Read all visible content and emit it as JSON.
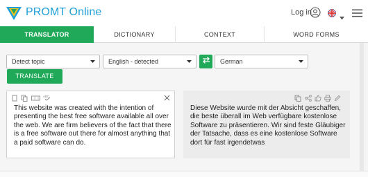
{
  "header": {
    "app_title": "PROMT Online",
    "login_label": "Log in",
    "brand_color": "#1f9fd8"
  },
  "tabs": [
    {
      "label": "TRANSLATOR",
      "active": true
    },
    {
      "label": "DICTIONARY",
      "active": false
    },
    {
      "label": "CONTEXT",
      "active": false
    },
    {
      "label": "WORD FORMS",
      "active": false
    }
  ],
  "controls": {
    "topic_select": "Detect topic",
    "source_lang_select": "English - detected",
    "target_lang_select": "German",
    "translate_button": "TRANSLATE",
    "accent_color": "#20a959"
  },
  "source": {
    "text": "This website was created with the intention of presenting the best free software available all over the web. We are firm believers of the fact that there is a free software out there for almost anything that a paid software can do."
  },
  "target": {
    "text": "Diese Website wurde mit der Absicht geschaffen, die beste überall im Web verfügbare kostenlose Software zu präsentieren. Wir sind feste Gläubiger der Tatsache, dass es eine kostenlose Software dort für fast irgendetwas"
  },
  "icons": {
    "logo": "promt-logo-icon",
    "user": "user-icon",
    "flag": "uk-flag-icon",
    "menu": "hamburger-menu-icon",
    "swap": "swap-arrows-icon",
    "close": "close-icon"
  }
}
